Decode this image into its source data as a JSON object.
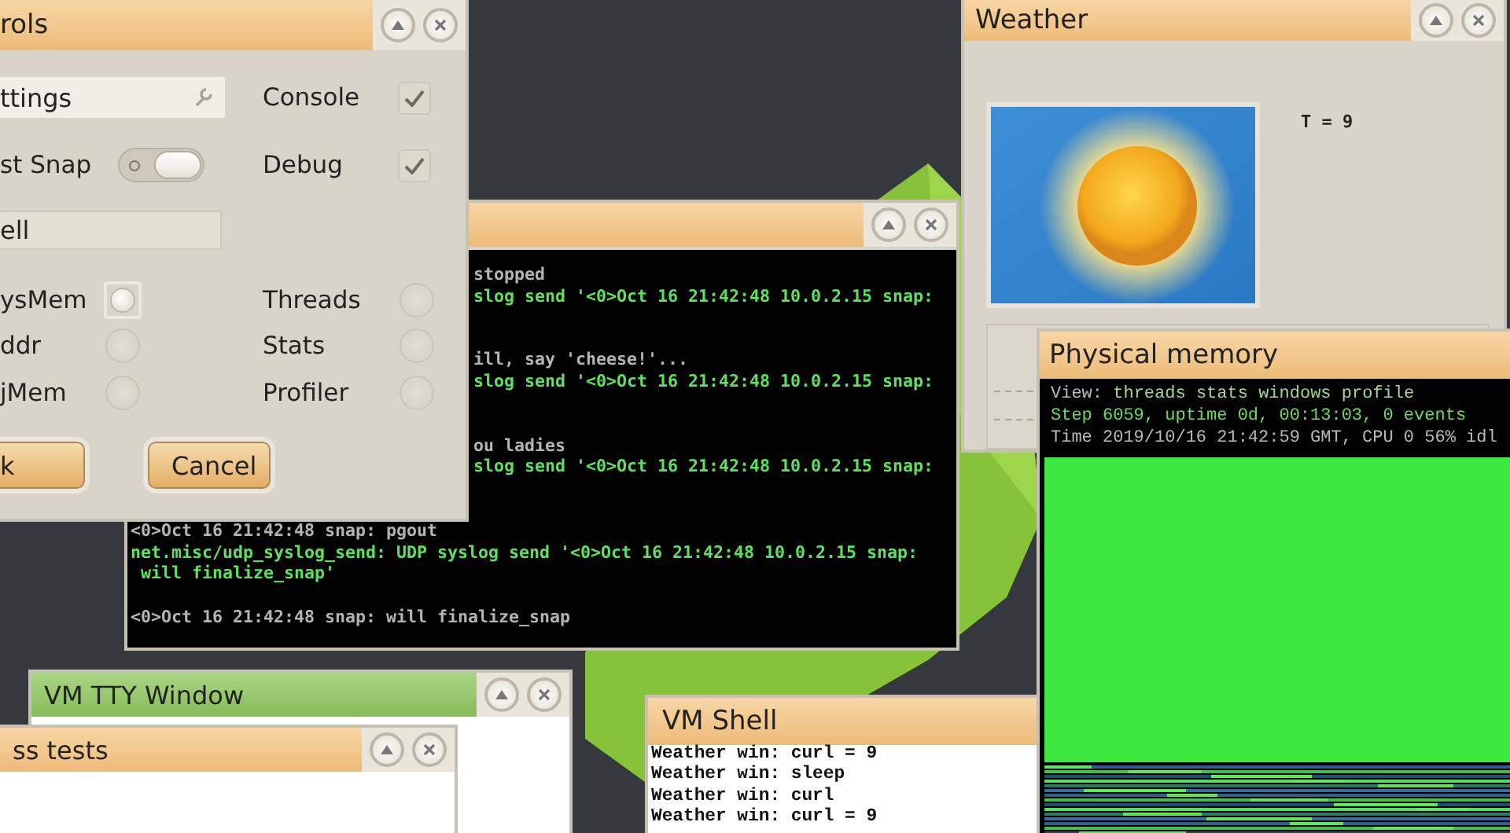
{
  "windows": [
    {
      "kind": "terminal",
      "active": false,
      "lines": [
        {
          "kind": "dim",
          "covered": true,
          "text": "stopped"
        },
        {
          "kind": "green",
          "covered": true,
          "text": "slog send '<0>Oct 16 21:42:48 10.0.2.15 snap:"
        },
        {
          "kind": "blank"
        },
        {
          "kind": "blank"
        },
        {
          "kind": "dim",
          "covered": true,
          "text": "ill, say 'cheese!'..."
        },
        {
          "kind": "green",
          "covered": true,
          "text": "slog send '<0>Oct 16 21:42:48 10.0.2.15 snap:"
        },
        {
          "kind": "blank"
        },
        {
          "kind": "blank"
        },
        {
          "kind": "dim",
          "covered": true,
          "text": "ou ladies"
        },
        {
          "kind": "green",
          "covered": true,
          "text": "slog send '<0>Oct 16 21:42:48 10.0.2.15 snap:"
        },
        {
          "kind": "blank"
        },
        {
          "kind": "blank"
        },
        {
          "kind": "dim",
          "covered": false,
          "text": "<0>Oct 16 21:42:48 snap: pgout"
        },
        {
          "kind": "green",
          "covered": false,
          "text": "net.misc/udp_syslog_send: UDP syslog send '<0>Oct 16 21:42:48 10.0.2.15 snap:"
        },
        {
          "kind": "green",
          "covered": false,
          "text": " will finalize_snap'"
        },
        {
          "kind": "blank"
        },
        {
          "kind": "dim",
          "covered": false,
          "text": "<0>Oct 16 21:42:48 snap: will finalize_snap"
        }
      ]
    },
    {
      "kind": "controls",
      "active": false,
      "title": "rols",
      "settings_field": {
        "value": "ttings"
      },
      "quick_snap": {
        "label": "st Snap",
        "on": true
      },
      "checkboxes": [
        {
          "label": "Console",
          "checked": true
        },
        {
          "label": "Debug",
          "checked": true
        }
      ],
      "shell_field": {
        "value": "ell"
      },
      "radios": [
        {
          "label": "ysMem",
          "selected": true
        },
        {
          "label": "Threads",
          "selected": false
        },
        {
          "label": "ddr",
          "selected": false
        },
        {
          "label": "Stats",
          "selected": false
        },
        {
          "label": "jMem",
          "selected": false
        },
        {
          "label": "Profiler",
          "selected": false
        }
      ],
      "buttons": [
        "k",
        "Cancel"
      ]
    },
    {
      "kind": "weather",
      "active": false,
      "title": "Weather",
      "temperature": "T = 9"
    },
    {
      "kind": "plain",
      "active": true,
      "title": "VM TTY Window"
    },
    {
      "kind": "plain",
      "active": false,
      "title": "ss tests"
    },
    {
      "kind": "shell",
      "active": false,
      "title": "VM Shell",
      "lines": [
        "Weather win: curl = 9",
        "Weather win: sleep",
        "Weather win: curl",
        "Weather win: curl = 9"
      ]
    },
    {
      "kind": "memory",
      "active": false,
      "title": "Physical memory",
      "view_label": "View:",
      "view_options": [
        "threads",
        "stats",
        "windows",
        "profile"
      ],
      "status_lines": [
        {
          "kind": "green",
          "text": "Step 6059, uptime 0d, 00:13:03, 0 events"
        },
        {
          "kind": "dim",
          "text": "Time 2019/10/16 21:42:59 GMT, CPU 0 56% idl"
        }
      ]
    }
  ]
}
